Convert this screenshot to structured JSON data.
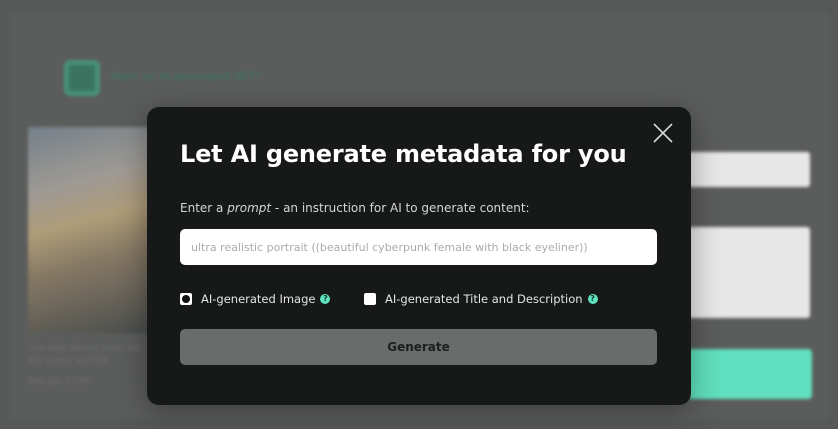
{
  "background": {
    "link_text": "Want an AI-generated NFT?",
    "caption": "The light shines over, Mit the scene and hill",
    "date": "Mar Jan 17:56"
  },
  "modal": {
    "title": "Let AI generate metadata for you",
    "instruction_before": "Enter a ",
    "instruction_emphasis": "prompt",
    "instruction_after": " - an instruction for AI to generate content:",
    "prompt_placeholder": "ultra realistic portrait ((beautiful cyberpunk female with black eyeliner))",
    "prompt_value": "",
    "options": [
      {
        "label": "AI-generated Image",
        "checked": true,
        "help": "?"
      },
      {
        "label": "AI-generated Title and Description",
        "checked": false,
        "help": "?"
      }
    ],
    "generate_label": "Generate",
    "close_icon": "close-icon"
  },
  "colors": {
    "modal_bg": "#171919",
    "accent": "#5fe3bf",
    "background_button": "#66ecc9",
    "generate_disabled": "#6a6c6b"
  }
}
